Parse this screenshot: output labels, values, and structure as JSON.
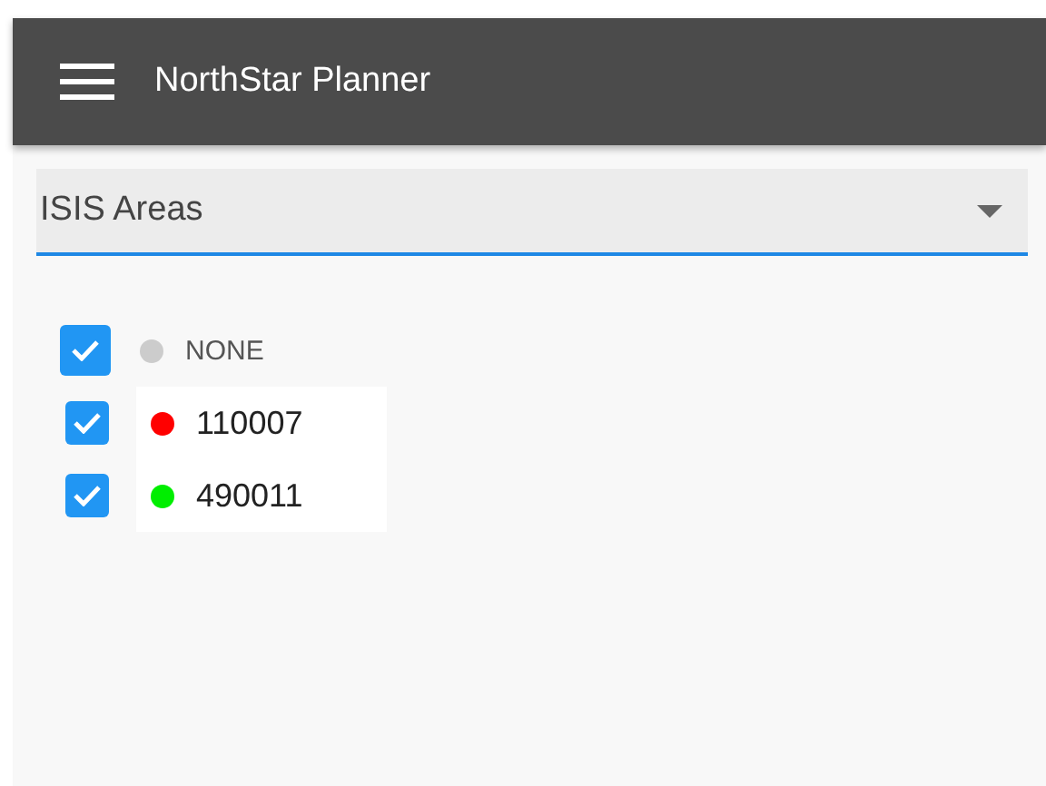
{
  "app_bar": {
    "title": "NorthStar Planner"
  },
  "select": {
    "value": "ISIS Areas"
  },
  "areas": [
    {
      "label": "NONE",
      "checked": true,
      "color": "#cccccc",
      "kind": "none"
    },
    {
      "label": "110007",
      "checked": true,
      "color": "#ff0000",
      "kind": "area"
    },
    {
      "label": "490011",
      "checked": true,
      "color": "#00ee00",
      "kind": "area"
    }
  ]
}
